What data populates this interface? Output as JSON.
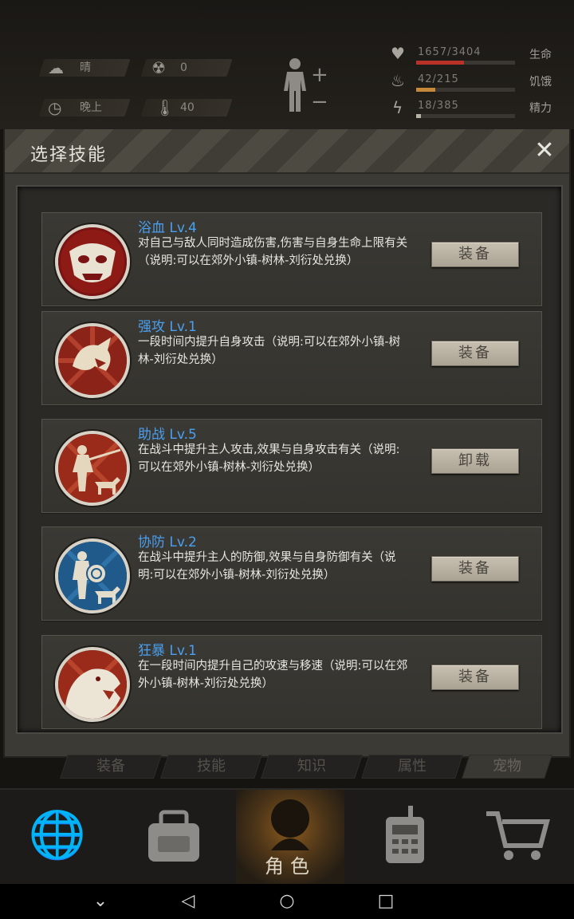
{
  "status": {
    "weather": "晴",
    "radiation": "0",
    "time_of_day": "晚上",
    "temperature": "40",
    "health": {
      "label": "生命",
      "text": "1657/3404",
      "fraction": 0.487
    },
    "hunger": {
      "label": "饥饿",
      "text": "42/215",
      "fraction": 0.195
    },
    "energy": {
      "label": "精力",
      "text": "18/385",
      "fraction": 0.047
    }
  },
  "modal": {
    "title": "选择技能",
    "close_icon": "close-icon"
  },
  "skills": [
    {
      "name": "浴血 Lv.4",
      "desc": "对自己与敌人同时造成伤害,伤害与自身生命上限有关（说明:可以在郊外小镇-树林-刘衍处兑换）",
      "button": "装备",
      "icon": "bloodbath-icon"
    },
    {
      "name": "强攻 Lv.1",
      "desc": "一段时间内提升自身攻击（说明:可以在郊外小镇-树林-刘衍处兑换）",
      "button": "装备",
      "icon": "power-attack-icon"
    },
    {
      "name": "助战 Lv.5",
      "desc": "在战斗中提升主人攻击,效果与自身攻击有关（说明:可以在郊外小镇-树林-刘衍处兑换）",
      "button": "卸载",
      "icon": "assist-battle-icon"
    },
    {
      "name": "协防 Lv.2",
      "desc": "在战斗中提升主人的防御,效果与自身防御有关（说明:可以在郊外小镇-树林-刘衍处兑换）",
      "button": "装备",
      "icon": "assist-defense-icon"
    },
    {
      "name": "狂暴 Lv.1",
      "desc": "在一段时间内提升自己的攻速与移速（说明:可以在郊外小镇-树林-刘衍处兑换）",
      "button": "装备",
      "icon": "rage-icon"
    }
  ],
  "sub_tabs": [
    "装备",
    "技能",
    "知识",
    "属性",
    "宠物"
  ],
  "bottom_nav": {
    "items": [
      "globe-icon",
      "backpack-icon",
      "character-icon",
      "radio-icon",
      "cart-icon"
    ],
    "active_label": "角色"
  },
  "colors": {
    "skill_name": "#4a9ff0",
    "health_bar": "#b8322a",
    "hunger_bar": "#c6883a",
    "energy_bar": "#b7b2a8"
  }
}
